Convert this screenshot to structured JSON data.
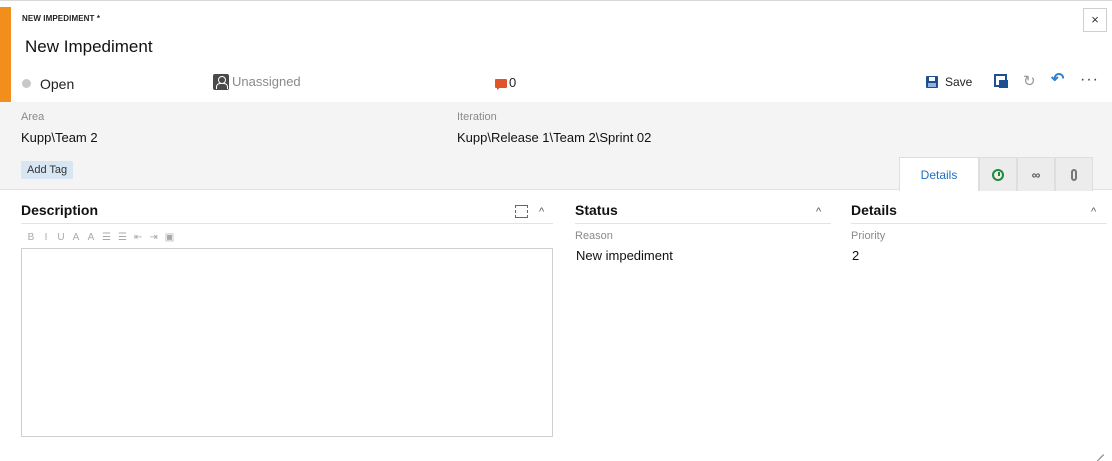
{
  "header": {
    "work_item_type": "NEW IMPEDIMENT *",
    "title": "New Impediment",
    "state": "Open",
    "assignee": "Unassigned",
    "comment_count": "0",
    "save_label": "Save",
    "close_glyph": "×",
    "refresh_glyph": "↻",
    "undo_glyph": "↶",
    "more_glyph": "···"
  },
  "fields": {
    "area_label": "Area",
    "area_value": "Kupp\\Team 2",
    "iteration_label": "Iteration",
    "iteration_value": "Kupp\\Release 1\\Team 2\\Sprint 02",
    "add_tag_label": "Add Tag"
  },
  "tabs": {
    "details_label": "Details",
    "link_glyph": "∞",
    "icons": [
      "history-icon",
      "links-icon",
      "attachments-icon"
    ]
  },
  "description": {
    "title": "Description",
    "collapse_glyph": "^",
    "toolbar": [
      "B",
      "I",
      "U",
      "A",
      "A",
      "☰",
      "☰",
      "⇤",
      "⇥",
      "▣"
    ]
  },
  "status": {
    "title": "Status",
    "collapse_glyph": "^",
    "reason_label": "Reason",
    "reason_value": "New impediment"
  },
  "details": {
    "title": "Details",
    "collapse_glyph": "^",
    "priority_label": "Priority",
    "priority_value": "2"
  },
  "colors": {
    "accent": "#f28e1c",
    "comment": "#e0542a",
    "save_blue": "#1d4f91",
    "link_blue": "#1e6fbf",
    "history_green": "#1e8a3c"
  }
}
